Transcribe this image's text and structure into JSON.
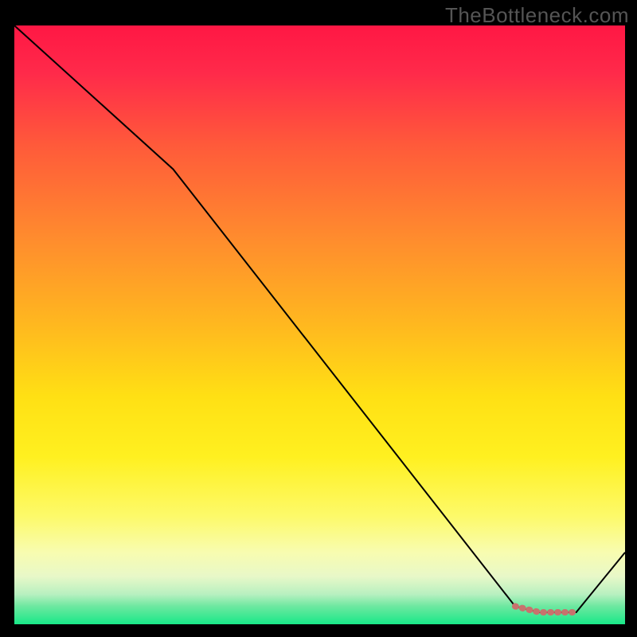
{
  "watermark": "TheBottleneck.com",
  "chart_data": {
    "type": "line",
    "title": "",
    "xlabel": "",
    "ylabel": "",
    "xlim": [
      0,
      100
    ],
    "ylim": [
      0,
      100
    ],
    "series": [
      {
        "name": "bottleneck-curve",
        "x": [
          0,
          26,
          82,
          86,
          92,
          100
        ],
        "y": [
          100,
          76,
          3,
          2,
          2,
          12
        ],
        "color": "#000000",
        "width": 2
      },
      {
        "name": "highlight-segment",
        "x": [
          82,
          86,
          92
        ],
        "y": [
          3,
          2,
          2
        ],
        "color": "#c8726d",
        "width": 8
      }
    ],
    "background_gradient": {
      "stops": [
        {
          "offset": 0.0,
          "color": "#ff1744"
        },
        {
          "offset": 0.08,
          "color": "#ff2a4a"
        },
        {
          "offset": 0.2,
          "color": "#ff5a3a"
        },
        {
          "offset": 0.35,
          "color": "#ff8a2e"
        },
        {
          "offset": 0.5,
          "color": "#ffb81f"
        },
        {
          "offset": 0.62,
          "color": "#ffe014"
        },
        {
          "offset": 0.72,
          "color": "#fff020"
        },
        {
          "offset": 0.82,
          "color": "#fdfa6a"
        },
        {
          "offset": 0.88,
          "color": "#f8fcb0"
        },
        {
          "offset": 0.92,
          "color": "#e8f8c8"
        },
        {
          "offset": 0.95,
          "color": "#b8f0c0"
        },
        {
          "offset": 0.97,
          "color": "#6de8a0"
        },
        {
          "offset": 1.0,
          "color": "#18e888"
        }
      ]
    }
  }
}
